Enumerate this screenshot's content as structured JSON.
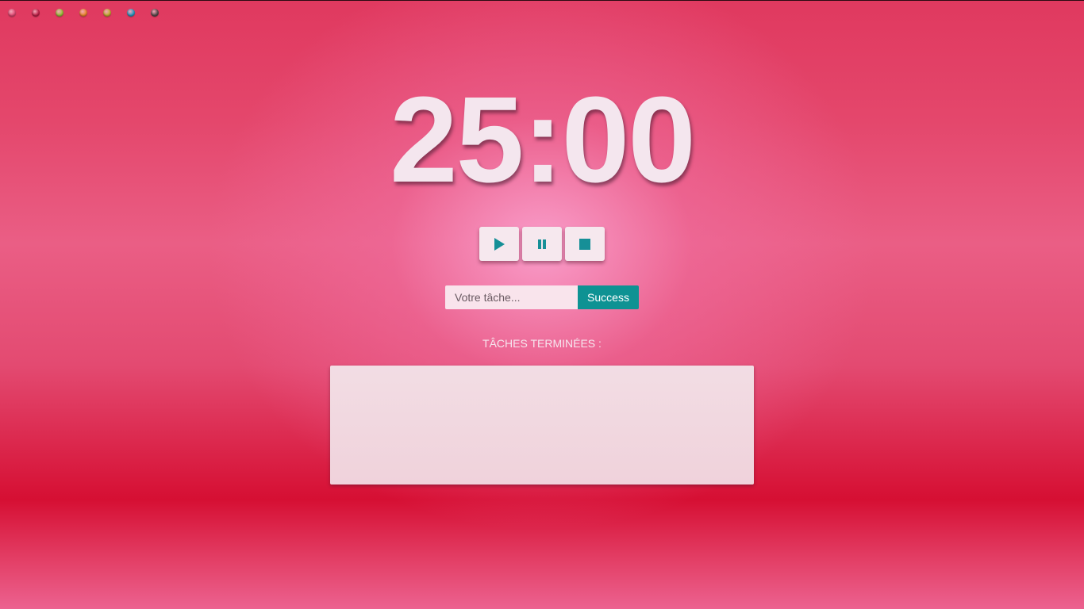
{
  "theme_dots": [
    {
      "name": "theme-dot-pink",
      "color": "#e8507a"
    },
    {
      "name": "theme-dot-crimson",
      "color": "#c2234a"
    },
    {
      "name": "theme-dot-green",
      "color": "#9ac43a"
    },
    {
      "name": "theme-dot-orange",
      "color": "#f08a2e"
    },
    {
      "name": "theme-dot-olive",
      "color": "#c8b030"
    },
    {
      "name": "theme-dot-blue",
      "color": "#2a9bc4"
    },
    {
      "name": "theme-dot-dark",
      "color": "#5a4a4c"
    }
  ],
  "timer": {
    "display": "25:00"
  },
  "controls": {
    "play_icon": "play-icon",
    "pause_icon": "pause-icon",
    "stop_icon": "stop-icon",
    "icon_color": "#168f97"
  },
  "task_form": {
    "placeholder": "Votre tâche...",
    "value": "",
    "submit_label": "Success"
  },
  "completed": {
    "title": "TÂCHES TERMINÉES :",
    "items": []
  }
}
